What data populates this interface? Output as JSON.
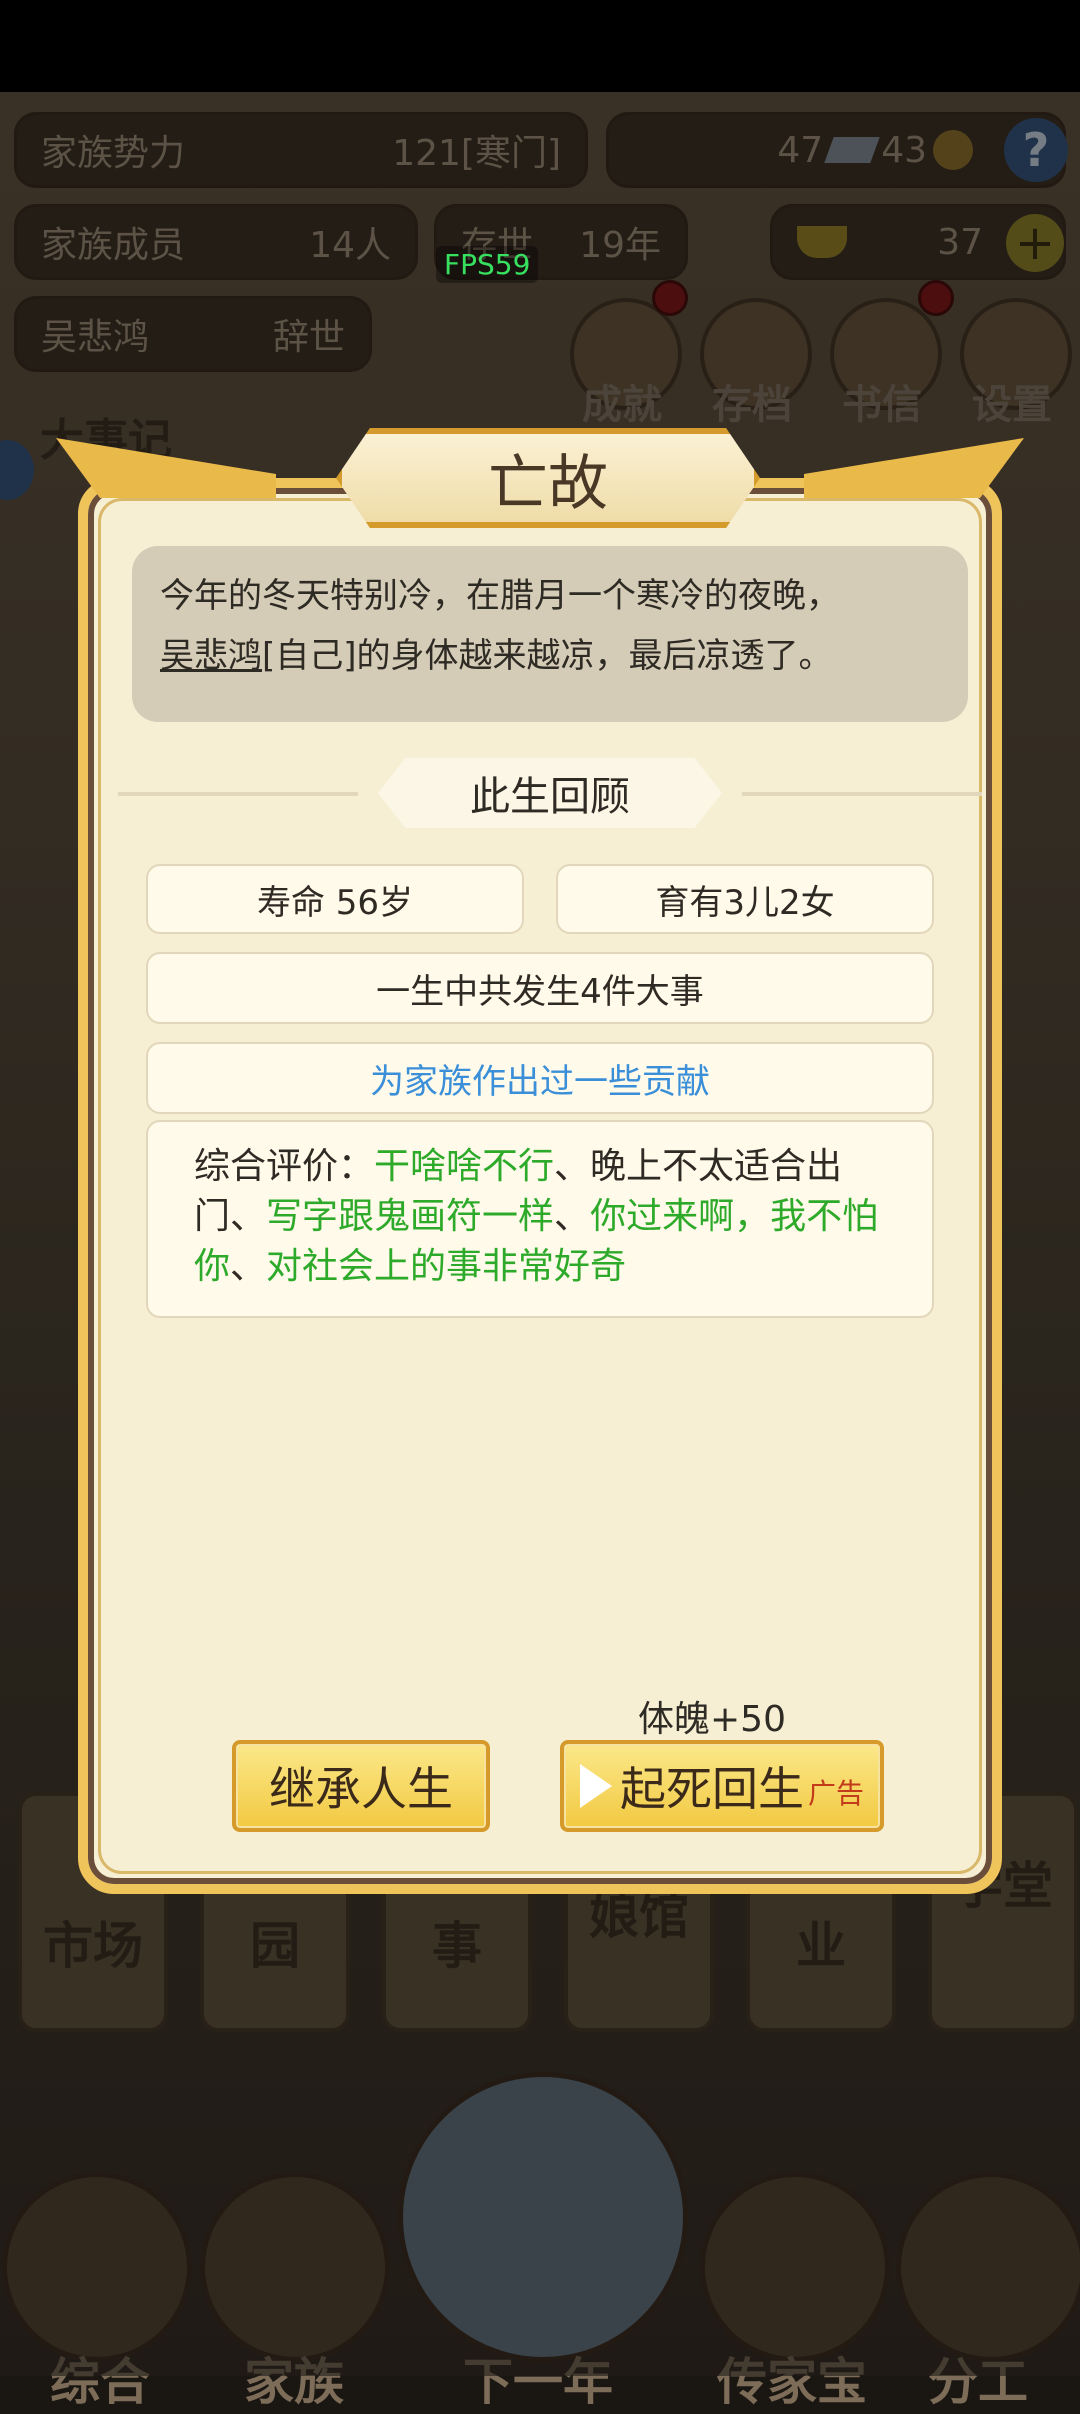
{
  "hud": {
    "power_label": "家族势力",
    "power_value": "121[寒门]",
    "currency_a": "47",
    "currency_b": "43",
    "members_label": "家族成员",
    "members_value": "14人",
    "alive_label": "存世",
    "alive_value": "19年",
    "gold_value": "37",
    "person_name": "吴悲鸿",
    "person_status": "辞世",
    "fps": "FPS59"
  },
  "top_menu": [
    {
      "label": "成就"
    },
    {
      "label": "存档"
    },
    {
      "label": "书信"
    },
    {
      "label": "设置"
    }
  ],
  "bg_title": "大事记",
  "nav_cards": [
    "市场",
    "园",
    "事",
    "娘馆",
    "业",
    "学堂"
  ],
  "bottom_nav": [
    "综合",
    "家族",
    "下一年",
    "传家宝",
    "分工"
  ],
  "dialog": {
    "title": "亡故",
    "story_line1": "今年的冬天特别冷，在腊月一个寒冷的夜晚，",
    "story_name": "吴悲鸿",
    "story_line2": "[自己]的身体越来越凉，最后凉透了。",
    "section_title": "此生回顾",
    "lifespan": "寿命 56岁",
    "children": "育有3儿2女",
    "events": "一生中共发生4件大事",
    "contribution": "为家族作出过一些贡献",
    "review_prefix": "综合评价：",
    "traits": [
      "干啥啥不行",
      "晚上不太适合出门",
      "写字跟鬼画符一样",
      "你过来啊，我不怕你",
      "对社会上的事非常好奇"
    ],
    "separator": "、",
    "bonus": "体魄+50",
    "inherit_button": "继承人生",
    "revive_button": "起死回生",
    "ad_tag": "广告"
  },
  "colors": {
    "accent_gold": "#efc45a",
    "trait_green": "#2eaa2a",
    "contribution_blue": "#3a8fd8",
    "ad_red": "#c23b1a"
  }
}
